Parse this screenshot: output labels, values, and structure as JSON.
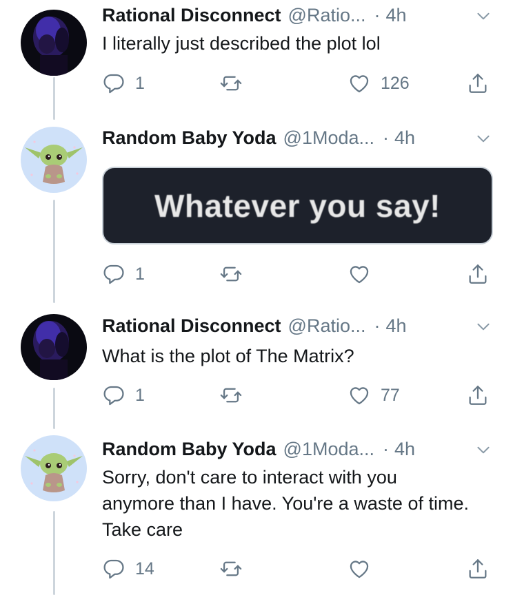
{
  "tweets": [
    {
      "name": "Rational Disconnect",
      "handle": "@Ratio...",
      "dot": "·",
      "time": "4h",
      "text": "I literally just described the plot lol",
      "reply_count": "1",
      "retweet_count": "",
      "like_count": "126",
      "avatar": "dark-portrait"
    },
    {
      "name": "Random Baby Yoda",
      "handle": "@1Moda...",
      "dot": "·",
      "time": "4h",
      "media_text": "Whatever you say!",
      "reply_count": "1",
      "retweet_count": "",
      "like_count": "",
      "avatar": "baby-yoda"
    },
    {
      "name": "Rational Disconnect",
      "handle": "@Ratio...",
      "dot": "·",
      "time": "4h",
      "text": "What is the plot of The Matrix?",
      "reply_count": "1",
      "retweet_count": "",
      "like_count": "77",
      "avatar": "dark-portrait"
    },
    {
      "name": "Random Baby Yoda",
      "handle": "@1Moda...",
      "dot": "·",
      "time": "4h",
      "text": "Sorry, don't care to interact with you anymore than I have. You're a waste of time. Take care",
      "reply_count": "14",
      "retweet_count": "",
      "like_count": "",
      "avatar": "baby-yoda"
    }
  ],
  "icons": {
    "reply": "reply-icon",
    "retweet": "retweet-icon",
    "like": "heart-icon",
    "share": "share-icon",
    "more": "chevron-down-icon"
  },
  "colors": {
    "name": "#14171a",
    "secondary": "#657786",
    "thread_line": "#cdd5dc",
    "media_bg": "#1d212b"
  }
}
